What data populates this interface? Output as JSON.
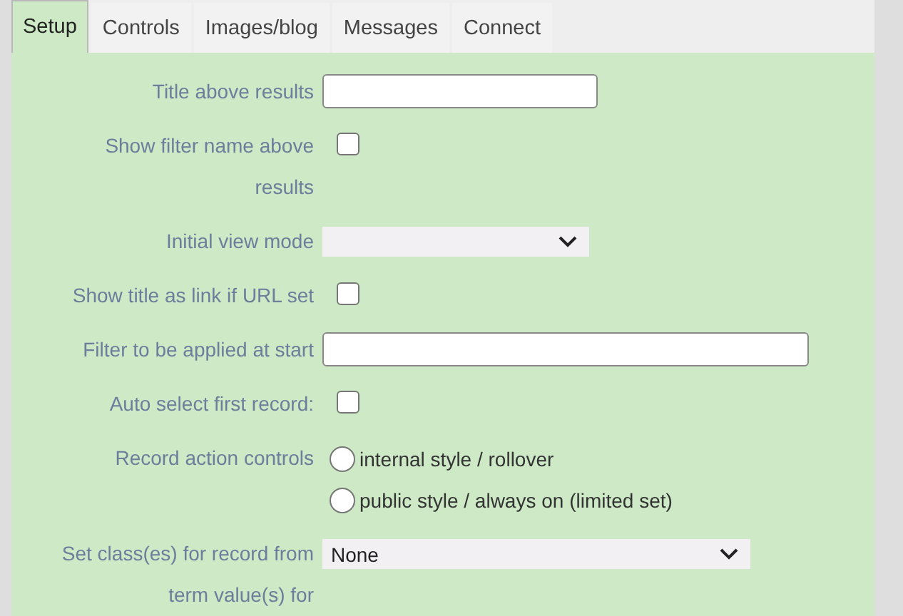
{
  "tabs": [
    {
      "label": "Setup",
      "selected": true
    },
    {
      "label": "Controls",
      "selected": false
    },
    {
      "label": "Images/blog",
      "selected": false
    },
    {
      "label": "Messages",
      "selected": false
    },
    {
      "label": "Connect",
      "selected": false
    }
  ],
  "fields": [
    {
      "kind": "text",
      "label": "Title above results"
    },
    {
      "kind": "checkbox",
      "label": "Show filter name above results",
      "checked": false
    },
    {
      "kind": "select",
      "label": "Initial view mode"
    },
    {
      "kind": "checkbox",
      "label": "Show title as link if URL set",
      "checked": false
    },
    {
      "kind": "widetext",
      "label": "Filter to be applied at start"
    },
    {
      "kind": "checkbox",
      "label": "Auto select first record:",
      "checked": false
    },
    {
      "kind": "radio",
      "label": "Record action controls",
      "options": [
        {
          "label": "internal style / rollover",
          "selected": false
        },
        {
          "label": "public style / always on (limited set)",
          "selected": false
        }
      ]
    },
    {
      "kind": "wideselect",
      "label": "Set class(es) for record from term value(s) for",
      "value": "None"
    }
  ]
}
